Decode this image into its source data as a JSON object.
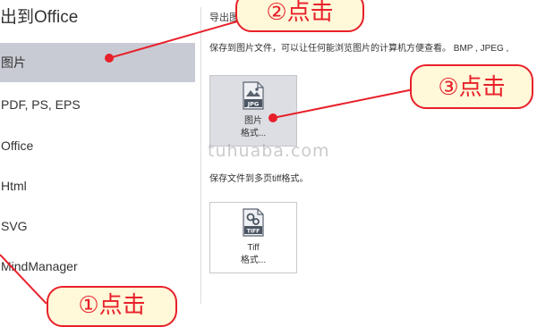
{
  "left": {
    "title": "出到Office",
    "items": [
      {
        "label": "图片"
      },
      {
        "label": "PDF, PS, EPS"
      },
      {
        "label": "Office"
      },
      {
        "label": "Html"
      },
      {
        "label": "SVG"
      },
      {
        "label": "MindManager"
      }
    ]
  },
  "right": {
    "section_label": "导出图",
    "image_desc": "保存到图片文件，可以让任何能浏览图片的计算机方便查看。 BMP , JPEG ,",
    "tiff_desc": "保存文件到多页tiff格式。",
    "image_tile": {
      "badge": "JPG",
      "line1": "图片",
      "line2": "格式..."
    },
    "tiff_tile": {
      "badge": "TIFF",
      "line1": "Tiff",
      "line2": "格式..."
    }
  },
  "callouts": {
    "step1": "①点击",
    "step2": "②点击",
    "step3": "③点击"
  },
  "watermark": "tuhuaba.com",
  "colors": {
    "accent_red": "#e8202a",
    "selected_bg": "#c8cbd3",
    "callout_bg": "#fff8d9"
  },
  "icons": {
    "image_tile": "jpg-file-icon",
    "tiff_tile": "tiff-file-icon"
  }
}
